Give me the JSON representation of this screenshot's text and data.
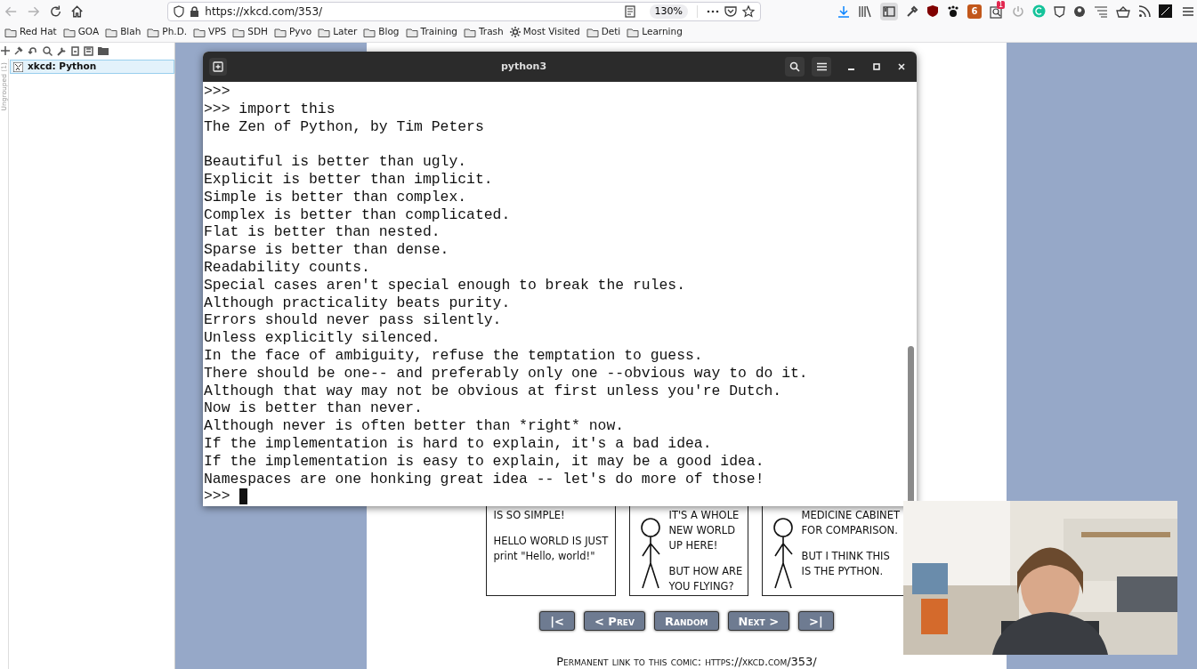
{
  "browser": {
    "url": "https://xkcd.com/353/",
    "zoom": "130%",
    "extension_badges": [
      {
        "kind": "number-box",
        "text": "6"
      },
      {
        "kind": "notification",
        "text": "1"
      }
    ]
  },
  "bookmarks": [
    {
      "label": "Red Hat",
      "kind": "folder"
    },
    {
      "label": "GOA",
      "kind": "folder"
    },
    {
      "label": "Blah",
      "kind": "folder"
    },
    {
      "label": "Ph.D.",
      "kind": "folder"
    },
    {
      "label": "VPS",
      "kind": "folder"
    },
    {
      "label": "SDH",
      "kind": "folder"
    },
    {
      "label": "Pyvo",
      "kind": "folder"
    },
    {
      "label": "Later",
      "kind": "folder"
    },
    {
      "label": "Blog",
      "kind": "folder"
    },
    {
      "label": "Training",
      "kind": "folder"
    },
    {
      "label": "Trash",
      "kind": "folder"
    },
    {
      "label": "Most Visited",
      "kind": "smart"
    },
    {
      "label": "Deti",
      "kind": "folder"
    },
    {
      "label": "Learning",
      "kind": "folder"
    }
  ],
  "sidebar": {
    "group_label": "Ungrouped (1)",
    "tabs": [
      {
        "title": "xkcd: Python",
        "selected": true
      }
    ]
  },
  "terminal": {
    "title": "python3",
    "cursor": true,
    "blocks": [
      [
        ">>>",
        ">>> import this",
        "The Zen of Python, by Tim Peters"
      ],
      [
        "Beautiful is better than ugly.",
        "Explicit is better than implicit.",
        "Simple is better than complex.",
        "Complex is better than complicated.",
        "Flat is better than nested.",
        "Sparse is better than dense.",
        "Readability counts.",
        "Special cases aren't special enough to break the rules.",
        "Although practicality beats purity.",
        "Errors should never pass silently.",
        "Unless explicitly silenced.",
        "In the face of ambiguity, refuse the temptation to guess.",
        "There should be one-- and preferably only one --obvious way to do it.",
        "Although that way may not be obvious at first unless you're Dutch.",
        "Now is better than never.",
        "Although never is often better than *right* now.",
        "If the implementation is hard to explain, it's a bad idea.",
        "If the implementation is easy to explain, it may be a good idea.",
        "Namespaces are one honking great idea -- let's do more of those!",
        ">>>"
      ]
    ]
  },
  "comic": {
    "panels": [
      {
        "texts": [
          "IS SO SIMPLE!",
          "HELLO WORLD IS JUST",
          "print \"Hello, world!\""
        ],
        "figure": false
      },
      {
        "texts": [
          "IT'S A WHOLE",
          "NEW WORLD",
          "UP HERE!",
          "BUT HOW ARE",
          "YOU FLYING?"
        ],
        "figure": true
      },
      {
        "texts": [
          "MEDICINE CABINET",
          "FOR COMPARISON.",
          "BUT I THINK THIS",
          "IS THE PYTHON."
        ],
        "figure": true
      }
    ]
  },
  "nav_buttons": [
    "|<",
    "< Prev",
    "Random",
    "Next >",
    ">|"
  ],
  "permalink": "Permanent link to this comic: https://xkcd.com/353/"
}
